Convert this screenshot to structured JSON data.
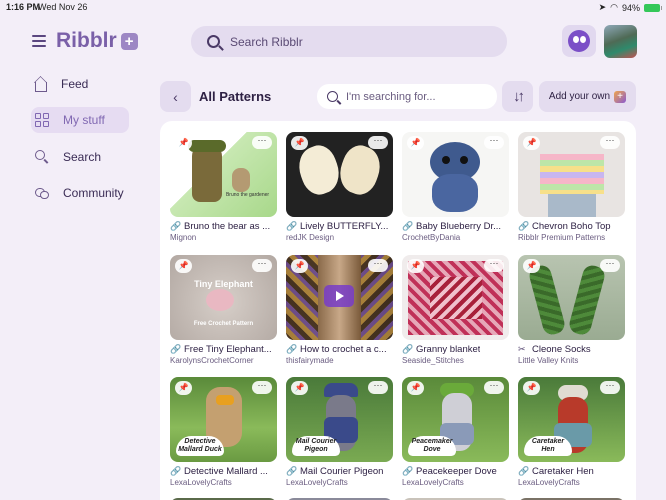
{
  "status_bar": {
    "time": "1:16 PM",
    "date": "Wed Nov 26",
    "battery": "94%"
  },
  "app": {
    "name": "Ribblr",
    "logo_badge": "+"
  },
  "header": {
    "search_placeholder": "Search Ribblr"
  },
  "sidebar": {
    "items": [
      {
        "label": "Feed",
        "icon": "house-icon",
        "active": false
      },
      {
        "label": "My stuff",
        "icon": "grid-icon",
        "active": true
      },
      {
        "label": "Search",
        "icon": "search-icon",
        "active": false
      },
      {
        "label": "Community",
        "icon": "chat-bubbles-icon",
        "active": false
      }
    ]
  },
  "toolbar": {
    "back_icon": "chevron-left-icon",
    "title": "All Patterns",
    "filter_placeholder": "I'm searching for...",
    "sort_icon": "sort-arrows-icon",
    "add_label": "Add your own"
  },
  "patterns": [
    {
      "title": "Bruno the bear as ...",
      "author": "Mignon",
      "icon": "link-icon",
      "thumb_caption": "Bruno the gardener"
    },
    {
      "title": "Lively BUTTERFLY...",
      "author": "redJK Design",
      "icon": "link-icon"
    },
    {
      "title": "Baby Blueberry Dr...",
      "author": "CrochetByDania",
      "icon": "link-icon"
    },
    {
      "title": "Chevron Boho Top",
      "author": "Ribblr Premium Patterns",
      "icon": "link-icon"
    },
    {
      "title": "Free Tiny Elephant...",
      "author": "KarolynsCrochetCorner",
      "icon": "link-icon",
      "thumb_caption": "Tiny Elephant",
      "thumb_caption2": "Free Crochet Pattern"
    },
    {
      "title": "How to crochet a c...",
      "author": "thisfairymade",
      "icon": "link-icon"
    },
    {
      "title": "Granny blanket",
      "author": "Seaside_Stitches",
      "icon": "link-icon"
    },
    {
      "title": "Cleone Socks",
      "author": "Little Valley Knits",
      "icon": "scissors-icon"
    },
    {
      "title": "Detective Mallard ...",
      "author": "LexaLovelyCrafts",
      "icon": "link-icon",
      "thumb_caption": "Detective Mallard Duck"
    },
    {
      "title": "Mail Courier Pigeon",
      "author": "LexaLovelyCrafts",
      "icon": "link-icon",
      "thumb_caption": "Mail Courier Pigeon"
    },
    {
      "title": "Peacekeeper Dove",
      "author": "LexaLovelyCrafts",
      "icon": "link-icon",
      "thumb_caption": "Peacemaker Dove"
    },
    {
      "title": "Caretaker Hen",
      "author": "LexaLovelyCrafts",
      "icon": "link-icon",
      "thumb_caption": "Caretaker Hen"
    }
  ],
  "colors": {
    "accent": "#8068b2",
    "background": "#f3eef8",
    "panel": "#ffffff"
  }
}
